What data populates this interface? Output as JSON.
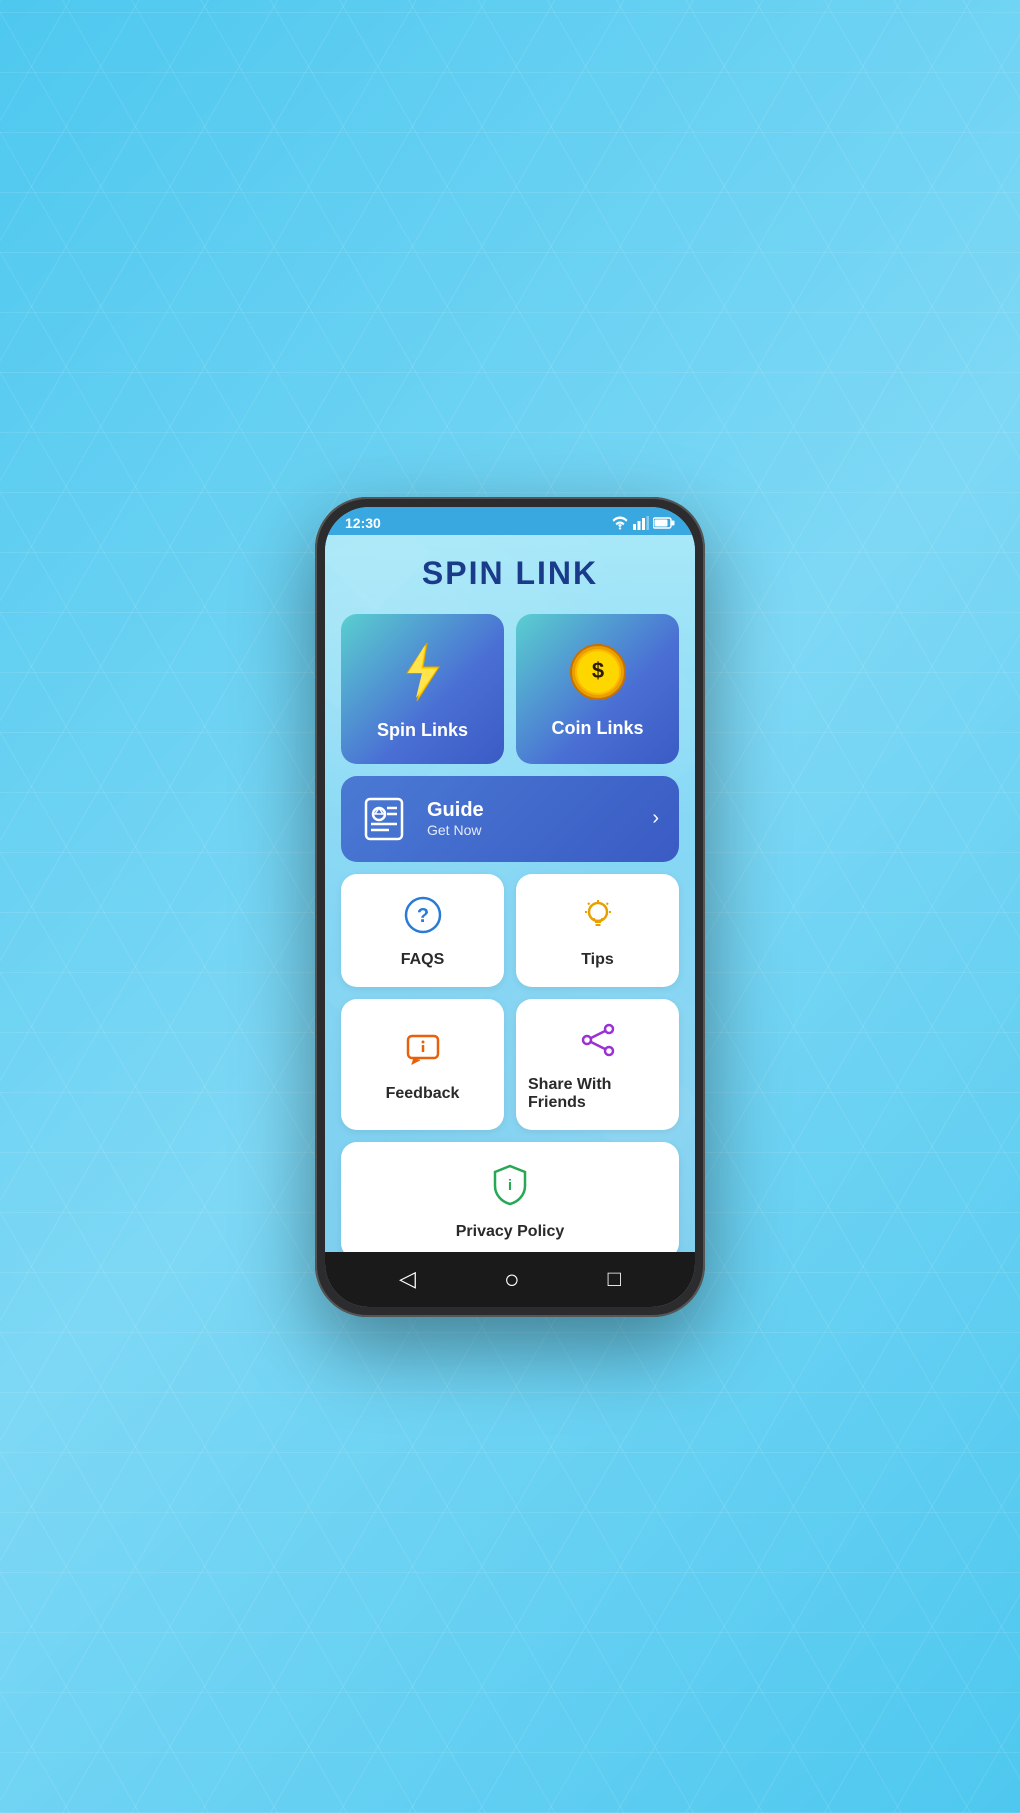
{
  "status_bar": {
    "time": "12:30",
    "icons": [
      "wifi",
      "signal",
      "battery"
    ]
  },
  "app": {
    "title": "SPIN LINK"
  },
  "top_cards": [
    {
      "id": "spin-links",
      "label": "Spin Links",
      "icon_type": "lightning"
    },
    {
      "id": "coin-links",
      "label": "Coin Links",
      "icon_type": "coin"
    }
  ],
  "guide_card": {
    "title": "Guide",
    "subtitle": "Get Now"
  },
  "grid_cards": {
    "row1": [
      {
        "id": "faqs",
        "label": "FAQS",
        "icon_type": "question"
      },
      {
        "id": "tips",
        "label": "Tips",
        "icon_type": "bulb"
      }
    ],
    "row2": [
      {
        "id": "feedback",
        "label": "Feedback",
        "icon_type": "feedback"
      },
      {
        "id": "share",
        "label": "Share With Friends",
        "icon_type": "share"
      }
    ],
    "row3": [
      {
        "id": "privacy",
        "label": "Privacy Policy",
        "icon_type": "shield"
      }
    ]
  },
  "nav": {
    "back": "◁",
    "home": "○",
    "recent": "□"
  }
}
